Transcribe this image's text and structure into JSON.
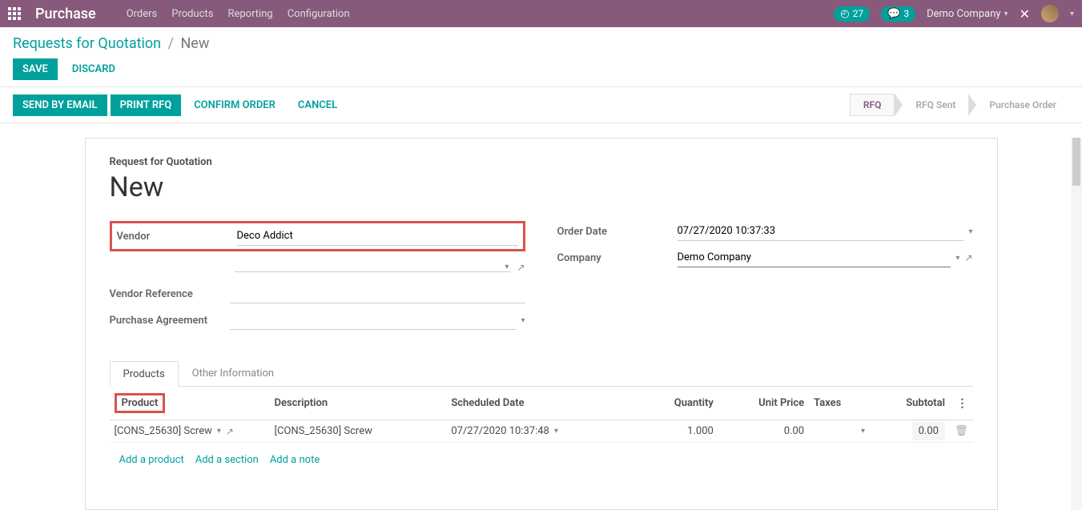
{
  "navbar": {
    "app_name": "Purchase",
    "menu": [
      "Orders",
      "Products",
      "Reporting",
      "Configuration"
    ],
    "clock_count": "27",
    "msg_count": "3",
    "company": "Demo Company"
  },
  "breadcrumb": {
    "root": "Requests for Quotation",
    "current": "New"
  },
  "buttons": {
    "save": "Save",
    "discard": "Discard",
    "send_email": "Send by Email",
    "print_rfq": "Print RFQ",
    "confirm": "Confirm Order",
    "cancel": "Cancel"
  },
  "status": {
    "rfq": "RFQ",
    "rfq_sent": "RFQ Sent",
    "po": "Purchase Order"
  },
  "form": {
    "title_label": "Request for Quotation",
    "title": "New",
    "labels": {
      "vendor": "Vendor",
      "vendor_ref": "Vendor Reference",
      "purchase_agreement": "Purchase Agreement",
      "order_date": "Order Date",
      "company": "Company"
    },
    "values": {
      "vendor": "Deco Addict",
      "vendor_ref": "",
      "purchase_agreement": "",
      "order_date": "07/27/2020 10:37:33",
      "company": "Demo Company"
    }
  },
  "tabs": {
    "products": "Products",
    "other": "Other Information"
  },
  "table": {
    "headers": {
      "product": "Product",
      "description": "Description",
      "scheduled_date": "Scheduled Date",
      "quantity": "Quantity",
      "unit_price": "Unit Price",
      "taxes": "Taxes",
      "subtotal": "Subtotal"
    },
    "rows": [
      {
        "product": "[CONS_25630] Screw",
        "description": "[CONS_25630] Screw",
        "scheduled_date": "07/27/2020 10:37:48",
        "quantity": "1.000",
        "unit_price": "0.00",
        "taxes": "",
        "subtotal": "0.00"
      }
    ],
    "add_links": {
      "product": "Add a product",
      "section": "Add a section",
      "note": "Add a note"
    }
  }
}
